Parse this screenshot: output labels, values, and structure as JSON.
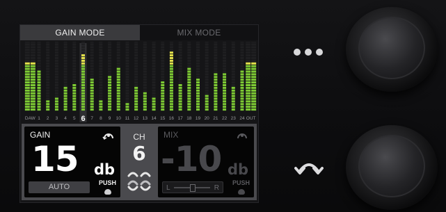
{
  "tabs": [
    {
      "label": "GAIN MODE",
      "active": true
    },
    {
      "label": "MIX MODE",
      "active": false
    }
  ],
  "meters": {
    "selected_channel": "6",
    "channels": [
      {
        "label": "DAW",
        "level": 0.71,
        "kind": "stereo"
      },
      {
        "label": "1",
        "level": 0.59,
        "kind": "mono"
      },
      {
        "label": "2",
        "level": 0.17,
        "kind": "mono"
      },
      {
        "label": "3",
        "level": 0.21,
        "kind": "mono"
      },
      {
        "label": "4",
        "level": 0.33,
        "kind": "mono"
      },
      {
        "label": "5",
        "level": 0.38,
        "kind": "mono"
      },
      {
        "label": "6",
        "level": 0.8,
        "kind": "mono",
        "selected": true
      },
      {
        "label": "7",
        "level": 0.47,
        "kind": "mono"
      },
      {
        "label": "8",
        "level": 0.14,
        "kind": "mono"
      },
      {
        "label": "9",
        "level": 0.5,
        "kind": "mono"
      },
      {
        "label": "10",
        "level": 0.6,
        "kind": "mono"
      },
      {
        "label": "11",
        "level": 0.1,
        "kind": "mono"
      },
      {
        "label": "12",
        "level": 0.33,
        "kind": "mono"
      },
      {
        "label": "13",
        "level": 0.26,
        "kind": "mono"
      },
      {
        "label": "14",
        "level": 0.2,
        "kind": "mono"
      },
      {
        "label": "15",
        "level": 0.41,
        "kind": "mono"
      },
      {
        "label": "16",
        "level": 0.86,
        "kind": "mono"
      },
      {
        "label": "17",
        "level": 0.38,
        "kind": "mono"
      },
      {
        "label": "18",
        "level": 0.6,
        "kind": "mono"
      },
      {
        "label": "19",
        "level": 0.45,
        "kind": "mono"
      },
      {
        "label": "20",
        "level": 0.23,
        "kind": "mono"
      },
      {
        "label": "21",
        "level": 0.52,
        "kind": "mono"
      },
      {
        "label": "22",
        "level": 0.54,
        "kind": "mono"
      },
      {
        "label": "23",
        "level": 0.36,
        "kind": "mono"
      },
      {
        "label": "24",
        "level": 0.58,
        "kind": "mono"
      },
      {
        "label": "OUT",
        "level": 0.71,
        "kind": "stereo"
      }
    ]
  },
  "gain": {
    "label": "GAIN",
    "value": "15",
    "unit": "db",
    "mode_button": "AUTO",
    "push_label": "PUSH",
    "icon": "gain-knob-icon"
  },
  "channel": {
    "label": "CH",
    "value": "6",
    "icon": "link-toggle-icon"
  },
  "mix": {
    "label": "MIX",
    "value": "-10",
    "unit": "db",
    "pan_left": "L",
    "pan_right": "R",
    "push_label": "PUSH",
    "icon": "mix-knob-icon"
  },
  "controls": {
    "menu_icon": "more-dots-icon",
    "rotate_icon": "rotate-arrow-icon"
  },
  "colors": {
    "accent_green": "#7ecb34",
    "meter_yellow": "#e4e14b",
    "meter_red": "#d95a2a",
    "mix_dim": "#5a5a5e"
  }
}
